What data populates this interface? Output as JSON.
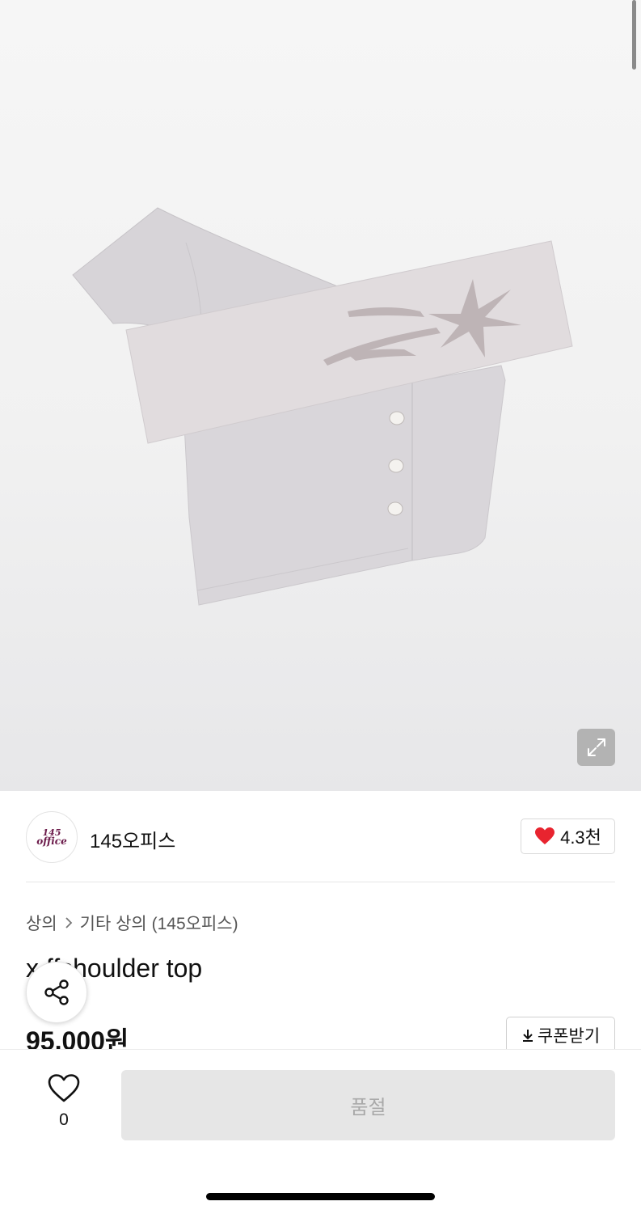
{
  "seller": {
    "logo_line1": "145",
    "logo_line2": "office",
    "name": "145오피스",
    "likes": "4.3천"
  },
  "breadcrumb": {
    "category": "상의",
    "subcategory": "기타 상의 (145오피스)"
  },
  "product": {
    "title": "x  ffshoulder top",
    "price": "95,000원"
  },
  "buttons": {
    "coupon": "쿠폰받기",
    "sold_out": "품절"
  },
  "wishlist": {
    "count": "0"
  },
  "colors": {
    "heart": "#e8242f",
    "sold_out_bg": "#e6e6e6",
    "sold_out_text": "#a9a9a9"
  },
  "icons": [
    "expand-icon",
    "heart-filled-icon",
    "chevron-right-icon",
    "share-icon",
    "download-icon",
    "heart-outline-icon"
  ]
}
